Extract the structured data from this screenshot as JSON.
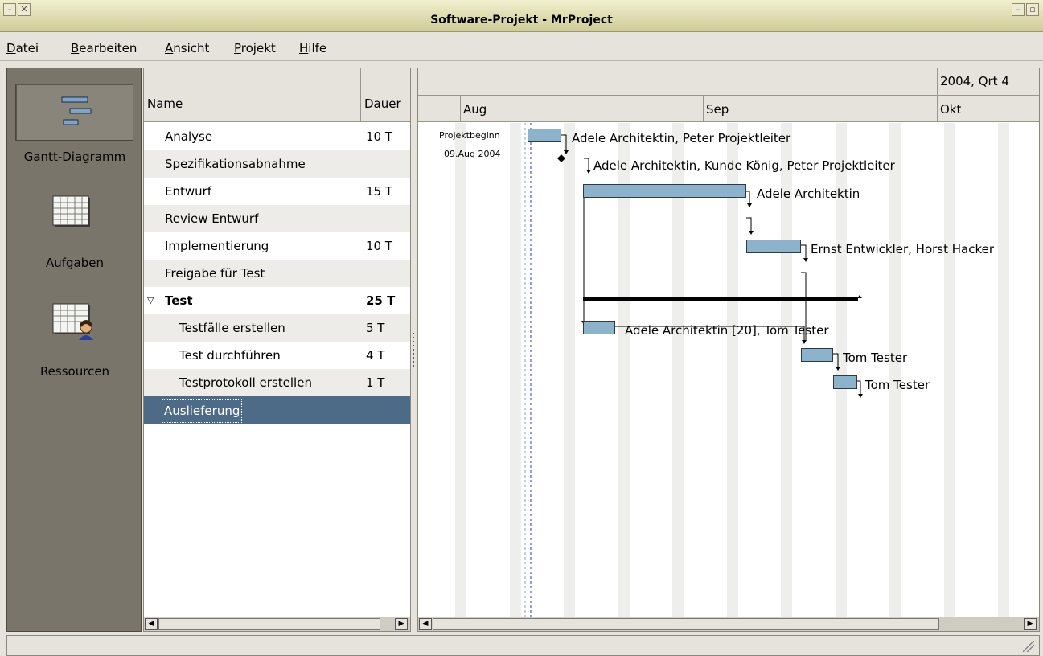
{
  "window": {
    "title": "Software-Projekt - MrProject"
  },
  "menu": {
    "datei": "Datei",
    "bearbeiten": "Bearbeiten",
    "ansicht": "Ansicht",
    "projekt": "Projekt",
    "hilfe": "Hilfe"
  },
  "sidebar": {
    "gantt": "Gantt-Diagramm",
    "aufgaben": "Aufgaben",
    "ressourcen": "Ressourcen"
  },
  "table": {
    "col_name": "Name",
    "col_dauer": "Dauer",
    "rows": [
      {
        "name": "Analyse",
        "dauer": "10 T"
      },
      {
        "name": "Spezifikationsabnahme",
        "dauer": ""
      },
      {
        "name": "Entwurf",
        "dauer": "15 T"
      },
      {
        "name": "Review Entwurf",
        "dauer": ""
      },
      {
        "name": "Implementierung",
        "dauer": "10 T"
      },
      {
        "name": "Freigabe für Test",
        "dauer": ""
      },
      {
        "name": "Test",
        "dauer": "25 T"
      },
      {
        "name": "Testfälle erstellen",
        "dauer": "5 T"
      },
      {
        "name": "Test durchführen",
        "dauer": "4 T"
      },
      {
        "name": "Testprotokoll erstellen",
        "dauer": "1 T"
      },
      {
        "name": "Auslieferung",
        "dauer": ""
      }
    ]
  },
  "gantt": {
    "quarter": "2004, Qrt 4",
    "months": {
      "aug": "Aug",
      "sep": "Sep",
      "okt": "Okt"
    },
    "project_start_label": "Projektbeginn",
    "project_start_date": "09.Aug 2004",
    "labels": {
      "analyse": "Adele Architektin, Peter Projektleiter",
      "spezifikation": "Adele Architektin, Kunde König, Peter Projektleiter",
      "entwurf": "Adele Architektin",
      "implementierung": "Ernst Entwickler, Horst Hacker",
      "testfaelle": "Adele Architektin [20], Tom Tester",
      "durchfuehren": "Tom Tester",
      "protokoll": "Tom Tester"
    },
    "colors": {
      "bar": "#8db3cc",
      "selection": "#4d6a86",
      "sidebar": "#7a756b"
    }
  }
}
